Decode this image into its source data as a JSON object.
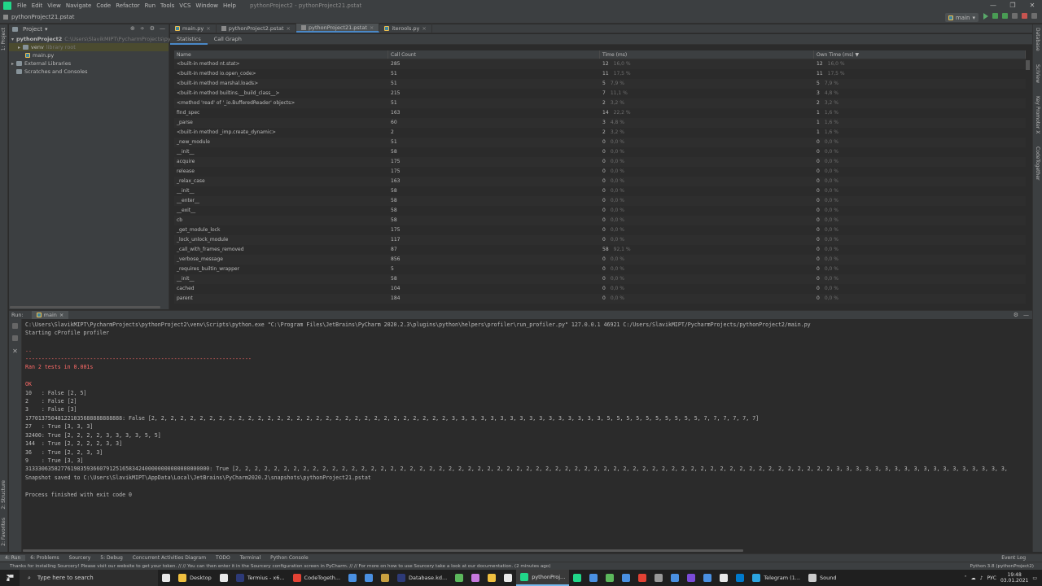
{
  "window": {
    "title": "pythonProject2 - pythonProject21.pstat",
    "menu": [
      "File",
      "Edit",
      "View",
      "Navigate",
      "Code",
      "Refactor",
      "Run",
      "Tools",
      "VCS",
      "Window",
      "Help"
    ],
    "controls": [
      "—",
      "❐",
      "✕"
    ]
  },
  "navbar": {
    "breadcrumb": "pythonProject21.pstat",
    "run_config": "main"
  },
  "project": {
    "header": "Project",
    "root_name": "pythonProject2",
    "root_path": "C:\\Users\\SlavikMIPT\\PycharmProjects\\pythonProj...",
    "venv": "venv",
    "venv_hint": "library root",
    "main_file": "main.py",
    "external": "External Libraries",
    "scratches": "Scratches and Consoles"
  },
  "tabs": [
    {
      "label": "main.py",
      "kind": "py"
    },
    {
      "label": "pythonProject2.pstat",
      "kind": "pstat"
    },
    {
      "label": "pythonProject21.pstat",
      "kind": "pstat",
      "active": true
    },
    {
      "label": "iterools.py",
      "kind": "py"
    }
  ],
  "subtabs": [
    "Statistics",
    "Call Graph"
  ],
  "table": {
    "headers": [
      "Name",
      "Call Count",
      "Time (ms)",
      "Own Time (ms) ▼"
    ],
    "rows": [
      [
        "<built-in method nt.stat>",
        "285",
        "12",
        "16,0 %",
        "12",
        "16,0 %"
      ],
      [
        "<built-in method io.open_code>",
        "51",
        "11",
        "17,5 %",
        "11",
        "17,5 %"
      ],
      [
        "<built-in method marshal.loads>",
        "51",
        "5",
        "7,9 %",
        "5",
        "7,9 %"
      ],
      [
        "<built-in method builtins.__build_class__>",
        "215",
        "7",
        "11,1 %",
        "3",
        "4,8 %"
      ],
      [
        "<method 'read' of '_io.BufferedReader' objects>",
        "51",
        "2",
        "3,2 %",
        "2",
        "3,2 %"
      ],
      [
        "find_spec",
        "163",
        "14",
        "22,2 %",
        "1",
        "1,6 %"
      ],
      [
        "_parse",
        "60",
        "3",
        "4,8 %",
        "1",
        "1,6 %"
      ],
      [
        "<built-in method _imp.create_dynamic>",
        "2",
        "2",
        "3,2 %",
        "1",
        "1,6 %"
      ],
      [
        "_new_module",
        "51",
        "0",
        "0,0 %",
        "0",
        "0,0 %"
      ],
      [
        "__init__",
        "58",
        "0",
        "0,0 %",
        "0",
        "0,0 %"
      ],
      [
        "acquire",
        "175",
        "0",
        "0,0 %",
        "0",
        "0,0 %"
      ],
      [
        "release",
        "175",
        "0",
        "0,0 %",
        "0",
        "0,0 %"
      ],
      [
        "_relax_case",
        "163",
        "0",
        "0,0 %",
        "0",
        "0,0 %"
      ],
      [
        "__init__",
        "58",
        "0",
        "0,0 %",
        "0",
        "0,0 %"
      ],
      [
        "__enter__",
        "58",
        "0",
        "0,0 %",
        "0",
        "0,0 %"
      ],
      [
        "__exit__",
        "58",
        "0",
        "0,0 %",
        "0",
        "0,0 %"
      ],
      [
        "cb",
        "58",
        "0",
        "0,0 %",
        "0",
        "0,0 %"
      ],
      [
        "_get_module_lock",
        "175",
        "0",
        "0,0 %",
        "0",
        "0,0 %"
      ],
      [
        "_lock_unlock_module",
        "117",
        "0",
        "0,0 %",
        "0",
        "0,0 %"
      ],
      [
        "_call_with_frames_removed",
        "87",
        "58",
        "92,1 %",
        "0",
        "0,0 %"
      ],
      [
        "_verbose_message",
        "856",
        "0",
        "0,0 %",
        "0",
        "0,0 %"
      ],
      [
        "_requires_builtin_wrapper",
        "5",
        "0",
        "0,0 %",
        "0",
        "0,0 %"
      ],
      [
        "__init__",
        "58",
        "0",
        "0,0 %",
        "0",
        "0,0 %"
      ],
      [
        "cached",
        "104",
        "0",
        "0,0 %",
        "0",
        "0,0 %"
      ],
      [
        "parent",
        "184",
        "0",
        "0,0 %",
        "0",
        "0,0 %"
      ]
    ]
  },
  "run": {
    "label": "Run:",
    "tab": "main",
    "lines": [
      {
        "t": "C:\\Users\\SlavikMIPT\\PycharmProjects\\pythonProject2\\venv\\Scripts\\python.exe \"C:\\Program Files\\JetBrains\\PyCharm 2020.2.3\\plugins\\python\\helpers\\profiler\\run_profiler.py\" 127.0.0.1 46921 C:/Users/SlavikMIPT/PycharmProjects/pythonProject2/main.py",
        "c": ""
      },
      {
        "t": "Starting cProfile profiler",
        "c": ""
      },
      {
        "t": "",
        "c": ""
      },
      {
        "t": "..",
        "c": "red"
      },
      {
        "t": "----------------------------------------------------------------------",
        "c": "red"
      },
      {
        "t": "Ran 2 tests in 0.001s",
        "c": "red"
      },
      {
        "t": "",
        "c": ""
      },
      {
        "t": "OK",
        "c": "red"
      },
      {
        "t": "10   : False [2, 5]",
        "c": ""
      },
      {
        "t": "2    : False [2]",
        "c": ""
      },
      {
        "t": "3    : False [3]",
        "c": ""
      },
      {
        "t": "177013750481221035688888888888: False [2, 2, 2, 2, 2, 2, 2, 2, 2, 2, 2, 2, 2, 2, 2, 2, 2, 2, 2, 2, 2, 2, 2, 2, 2, 2, 2, 2, 2, 2, 2, 3, 3, 3, 3, 3, 3, 3, 3, 3, 3, 3, 3, 3, 3, 3, 3, 5, 5, 5, 5, 5, 5, 5, 5, 5, 5, 7, 7, 7, 7, 7, 7]",
        "c": ""
      },
      {
        "t": "27   : True [3, 3, 3]",
        "c": ""
      },
      {
        "t": "32400: True [2, 2, 2, 2, 3, 3, 3, 3, 5, 5]",
        "c": ""
      },
      {
        "t": "144  : True [2, 2, 2, 2, 3, 3]",
        "c": ""
      },
      {
        "t": "36   : True [2, 2, 3, 3]",
        "c": ""
      },
      {
        "t": "9    : True [3, 3]",
        "c": ""
      },
      {
        "t": "313330635827761983593660791251658342400000000000000000000: True [2, 2, 2, 2, 2, 2, 2, 2, 2, 2, 2, 2, 2, 2, 2, 2, 2, 2, 2, 2, 2, 2, 2, 2, 2, 2, 2, 2, 2, 2, 2, 2, 2, 2, 2, 2, 2, 2, 2, 2, 2, 2, 2, 2, 2, 2, 2, 2, 2, 2, 2, 2, 2, 2, 2, 2, 2, 2, 2, 2, 2, 2, 3, 3, 3, 3, 3, 3, 3, 3, 3, 3, 3, 3, 3, 3, 3, 3, 3, 3,",
        "c": ""
      },
      {
        "t": "Snapshot saved to C:\\Users\\SlavikMIPT\\AppData\\Local\\JetBrains\\PyCharm2020.2\\snapshots\\pythonProject21.pstat",
        "c": ""
      },
      {
        "t": "",
        "c": ""
      },
      {
        "t": "Process finished with exit code 0",
        "c": ""
      }
    ]
  },
  "left_stripe": [
    "1: Project",
    "2: Structure",
    "2: Favorites"
  ],
  "right_stripe": [
    "Database",
    "SciView",
    "Key Promoter X",
    "CodeTogether"
  ],
  "tooltabs": [
    "4: Run",
    "6: Problems",
    "Sourcery",
    "5: Debug",
    "Concurrent Activities Diagram",
    "TODO",
    "Terminal",
    "Python Console"
  ],
  "event_log": "Event Log",
  "status": {
    "message": "Thanks for installing Sourcery! Please visit our website to get your token. // // You can then enter it in the Sourcery configuration screen in PyCharm. // // For more on how to use Sourcery take a look at our documentation. (2 minutes ago)",
    "interpreter": "Python 3.8 (pythonProject2)"
  },
  "taskbar": {
    "search": "Type here to search",
    "apps": [
      {
        "label": "",
        "color": "#e8e8e8"
      },
      {
        "label": "Desktop",
        "color": "#f0c040"
      },
      {
        "label": "",
        "color": "#e8e8e8"
      },
      {
        "label": "Termius - x6...",
        "color": "#2d3a78"
      },
      {
        "label": "CodeTogeth...",
        "color": "#e34234"
      },
      {
        "label": "",
        "color": "#4a90e2"
      },
      {
        "label": "",
        "color": "#4a90e2"
      },
      {
        "label": "",
        "color": "#c8a040"
      },
      {
        "label": "Database.kd...",
        "color": "#2d3a78"
      },
      {
        "label": "",
        "color": "#5cb85c"
      },
      {
        "label": "",
        "color": "#c678dd"
      },
      {
        "label": "",
        "color": "#f0c040"
      },
      {
        "label": "",
        "color": "#e8e8e8"
      },
      {
        "label": "pythonProj...",
        "color": "#21d789",
        "active": true
      },
      {
        "label": "",
        "color": "#21d789"
      },
      {
        "label": "",
        "color": "#4a90e2"
      },
      {
        "label": "",
        "color": "#5cb85c"
      },
      {
        "label": "",
        "color": "#4a90e2"
      },
      {
        "label": "",
        "color": "#e34234"
      },
      {
        "label": "",
        "color": "#999"
      },
      {
        "label": "",
        "color": "#4a90e2"
      },
      {
        "label": "",
        "color": "#7b4bd8"
      },
      {
        "label": "",
        "color": "#4a90e2"
      },
      {
        "label": "",
        "color": "#e8e8e8"
      },
      {
        "label": "",
        "color": "#007acc"
      },
      {
        "label": "Telegram (1...",
        "color": "#2ca5e0"
      },
      {
        "label": "Sound",
        "color": "#cccccc"
      }
    ],
    "lang": "РУС",
    "time": "19:48",
    "date": "03.01.2021"
  }
}
